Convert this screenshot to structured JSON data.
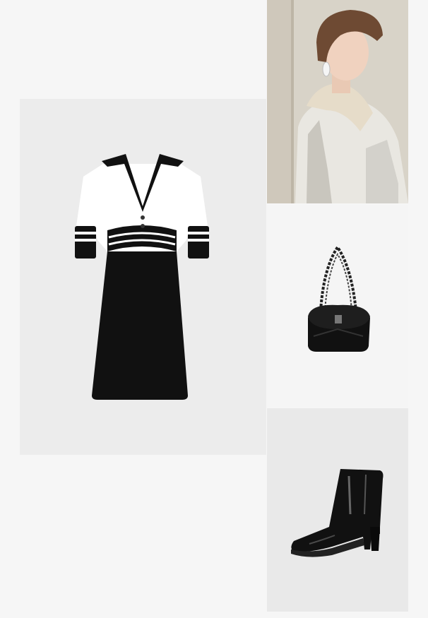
{
  "outfit": {
    "items": [
      {
        "name": "dress",
        "alt": "",
        "icon": "dress-product-image"
      },
      {
        "name": "model",
        "alt": "",
        "icon": "model-photo"
      },
      {
        "name": "bag",
        "alt": "",
        "icon": "bag-product-image"
      },
      {
        "name": "boots",
        "alt": "",
        "icon": "boot-product-image"
      }
    ]
  },
  "colors": {
    "page_background": "#f6f6f6",
    "tile_background": "#ececec",
    "garment_black": "#111111",
    "garment_white": "#ffffff"
  }
}
